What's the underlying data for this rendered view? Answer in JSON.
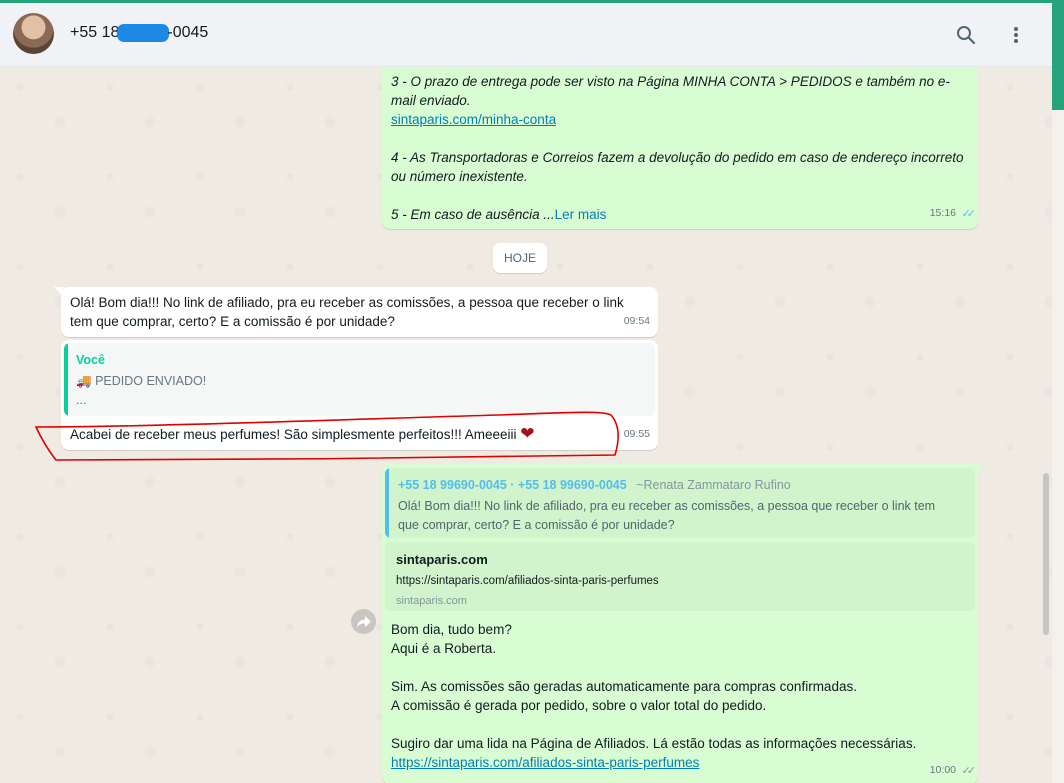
{
  "header": {
    "contact_prefix": "+55 18",
    "contact_suffix": "-0045",
    "search_label": "Pesquisar",
    "menu_label": "Mais opções"
  },
  "messages": {
    "m1": {
      "line1": "3 - O prazo de entrega pode ser visto na Página MINHA CONTA > PEDIDOS e também no e-",
      "line2": "mail enviado.",
      "link": "sintaparis.com/minha-conta",
      "line4": "4 - As Transportadoras e Correios fazem a devolução do pedido em caso de endereço incorreto",
      "line5": "ou número inexistente.",
      "line6": "5 - Em caso de ausência ...",
      "read_more": "Ler mais",
      "time": "15:16"
    },
    "day_separator": "HOJE",
    "m2": {
      "line1": "Olá! Bom dia!!! No link de afiliado, pra eu receber as comissões, a pessoa que receber o link",
      "line2": "tem que comprar, certo? E a comissão é por unidade?",
      "time": "09:54"
    },
    "m3": {
      "quote_author": "Você",
      "quote_emoji": "🚚",
      "quote_text": "PEDIDO ENVIADO!",
      "quote_ellipsis": "...",
      "text": "Acabei de receber meus perfumes! São simplesmente perfeitos!!! Ameeeiii",
      "heart": "❤",
      "time": "09:55"
    },
    "m4": {
      "quote_numbers": "+55 18 99690-0045 · +55 18 99690-0045",
      "quote_name": "~Renata Zammataro Rufino",
      "quote_line1": "Olá! Bom dia!!! No link de afiliado, pra eu receber as comissões, a pessoa que receber o link tem",
      "quote_line2": "que comprar, certo? E a comissão é por unidade?",
      "preview_title": "sintaparis.com",
      "preview_url": "https://sintaparis.com/afiliados-sinta-paris-perfumes",
      "preview_domain": "sintaparis.com",
      "line1": "Bom dia, tudo bem?",
      "line2": "Aqui é a Roberta.",
      "line3": "Sim. As comissões são geradas automaticamente para compras confirmadas.",
      "line4": "A comissão é gerada por pedido, sobre o valor total do pedido.",
      "line5": "Sugiro dar uma lida na Página de Afiliados. Lá estão todas as informações necessárias.",
      "link": "https://sintaparis.com/afiliados-sinta-paris-perfumes",
      "time": "10:00"
    }
  },
  "colors": {
    "accent": "#25a37a",
    "outgoing_bubble": "#d9fdd3",
    "incoming_bubble": "#ffffff",
    "link": "#027eb5",
    "annotation": "#e00000",
    "read_ticks": "#53bdeb"
  }
}
